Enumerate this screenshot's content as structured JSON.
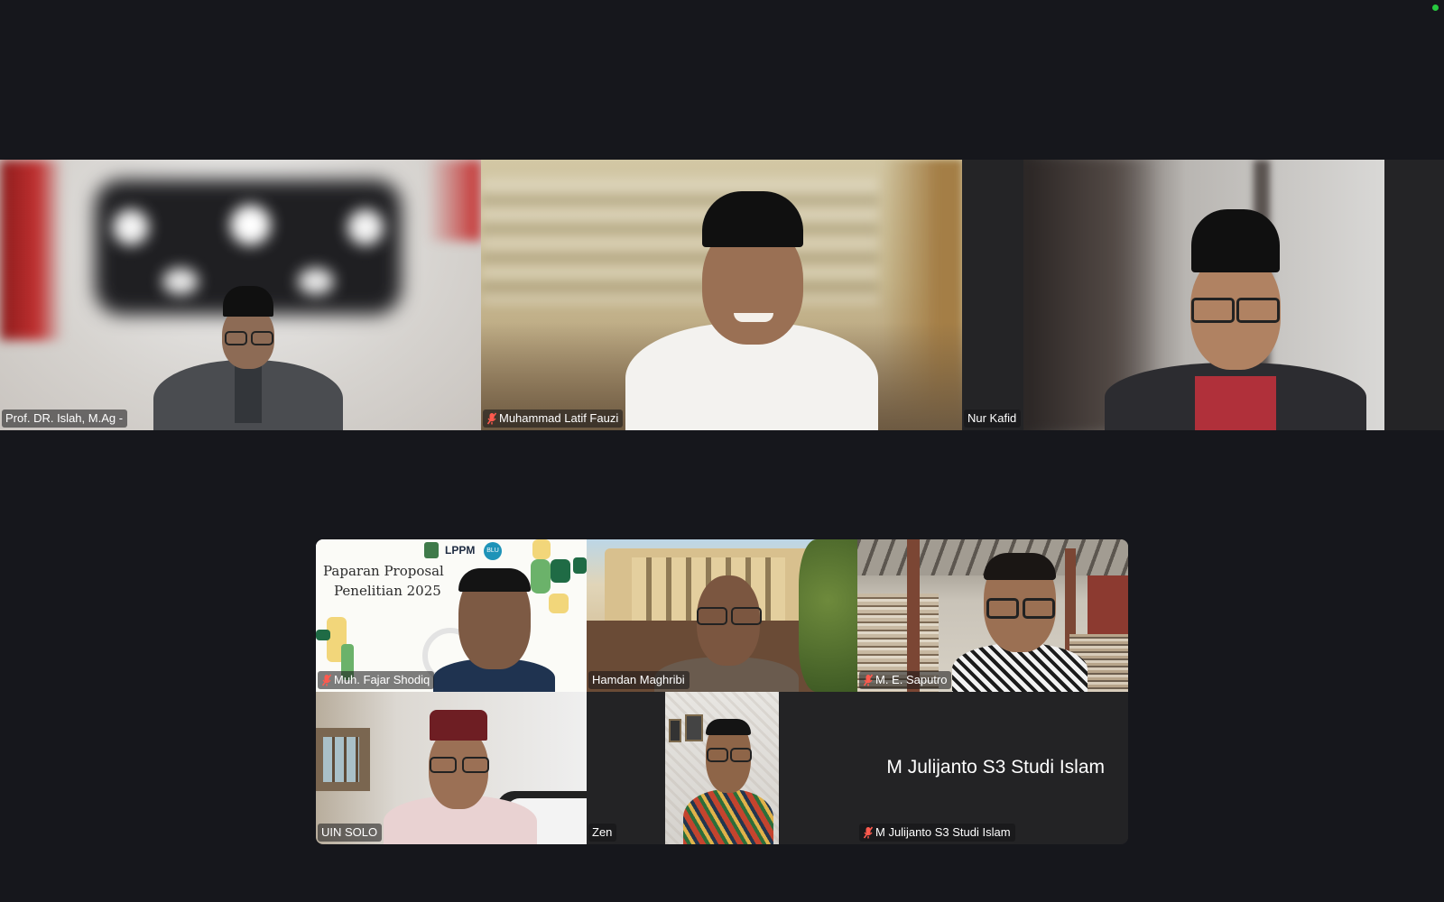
{
  "app": {
    "status_color": "#27c93f",
    "background": "#16171c"
  },
  "top_row": [
    {
      "name": "Prof. DR. Islah, M.Ag -",
      "muted": false
    },
    {
      "name": "Muhammad Latif Fauzi",
      "muted": true
    },
    {
      "name": "Nur Kafid",
      "muted": false
    }
  ],
  "bottom_grid": [
    {
      "name": "Muh. Fajar Shodiq",
      "muted": true
    },
    {
      "name": "Hamdan Maghribi",
      "muted": false
    },
    {
      "name": "M. E. Saputro",
      "muted": true
    },
    {
      "name": "UIN SOLO",
      "muted": false
    },
    {
      "name": "Zen",
      "muted": false
    },
    {
      "name": "M Julijanto S3 Studi Islam",
      "muted": true,
      "video_off": true,
      "big_label": "M Julijanto S3 Studi Islam"
    }
  ],
  "slide": {
    "line1": "Paparan Proposal",
    "line2": "Penelitian 2025",
    "logo_text": "LPPM",
    "badge_text": "BLU"
  },
  "icons": {
    "muted": "mic-muted-icon"
  }
}
